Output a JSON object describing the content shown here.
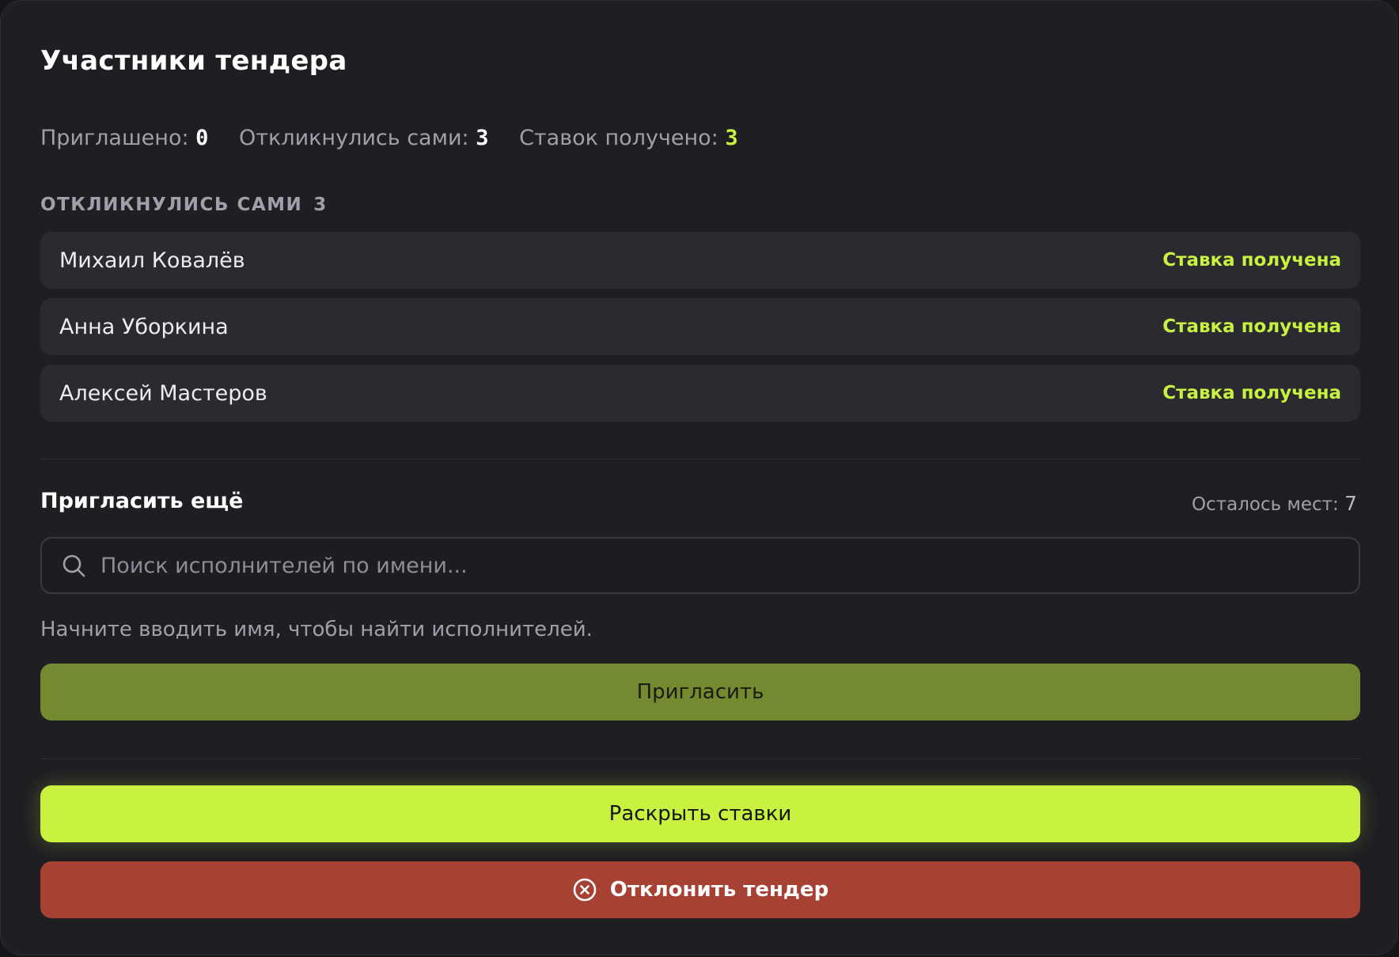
{
  "title": "Участники тендера",
  "stats": {
    "invited_label": "Приглашено:",
    "invited_value": "0",
    "responded_label": "Откликнулись сами:",
    "responded_value": "3",
    "bids_label": "Ставок получено:",
    "bids_value": "3"
  },
  "responded_section": {
    "label": "ОТКЛИКНУЛИСЬ САМИ",
    "count": "3",
    "participants": [
      {
        "name": "Михаил Ковалёв",
        "status": "Ставка получена"
      },
      {
        "name": "Анна Уборкина",
        "status": "Ставка получена"
      },
      {
        "name": "Алексей Мастеров",
        "status": "Ставка получена"
      }
    ]
  },
  "invite": {
    "title": "Пригласить ещё",
    "remaining_label": "Осталось мест:",
    "remaining_value": "7",
    "search_placeholder": "Поиск исполнителей по имени...",
    "search_value": "",
    "hint": "Начните вводить имя, чтобы найти исполнителей.",
    "invite_button": "Пригласить"
  },
  "actions": {
    "reveal_button": "Раскрыть ставки",
    "reject_button": "Отклонить тендер"
  },
  "colors": {
    "accent": "#c8f23f",
    "invite_button": "#748a31",
    "reject_button": "#a74134",
    "panel": "#1e1e23"
  },
  "icons": {
    "search": "search-icon",
    "reject": "close-circle-icon"
  }
}
